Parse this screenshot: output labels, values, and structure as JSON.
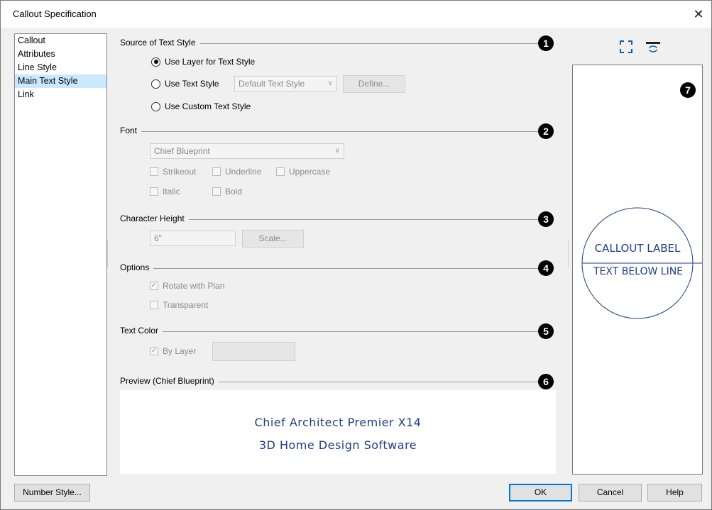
{
  "window": {
    "title": "Callout Specification",
    "close_label": "✕"
  },
  "nav": {
    "items": [
      {
        "label": "Callout"
      },
      {
        "label": "Attributes"
      },
      {
        "label": "Line Style"
      },
      {
        "label": "Main Text Style",
        "selected": true
      },
      {
        "label": "Link"
      }
    ]
  },
  "sections": {
    "source": {
      "label": "Source of Text Style",
      "num": "1"
    },
    "font": {
      "label": "Font",
      "num": "2"
    },
    "height": {
      "label": "Character Height",
      "num": "3"
    },
    "options": {
      "label": "Options",
      "num": "4"
    },
    "color": {
      "label": "Text Color",
      "num": "5"
    },
    "preview": {
      "label": "Preview (Chief Blueprint)",
      "num": "6"
    },
    "right": {
      "num": "7"
    }
  },
  "source": {
    "use_layer": "Use Layer for Text Style",
    "use_text_style": "Use Text Style",
    "text_style_value": "Default Text Style",
    "define_button": "Define...",
    "use_custom": "Use Custom Text Style",
    "selected": "use_layer"
  },
  "font": {
    "font_value": "Chief Blueprint",
    "strikeout": "Strikeout",
    "underline": "Underline",
    "uppercase": "Uppercase",
    "italic": "Italic",
    "bold": "Bold"
  },
  "height": {
    "value": "6\"",
    "scale_button": "Scale..."
  },
  "options": {
    "rotate": "Rotate with Plan",
    "rotate_checked": true,
    "transparent": "Transparent",
    "transparent_checked": false
  },
  "color": {
    "by_layer": "By Layer",
    "by_layer_checked": true
  },
  "preview": {
    "line1": "Chief Architect Premier X14",
    "line2": "3D Home Design Software"
  },
  "callout_preview": {
    "label_top": "CALLOUT LABEL",
    "label_bottom": "TEXT BELOW LINE",
    "stroke_color": "#1f3c88"
  },
  "footer": {
    "number_style": "Number Style...",
    "ok": "OK",
    "cancel": "Cancel",
    "help": "Help"
  }
}
